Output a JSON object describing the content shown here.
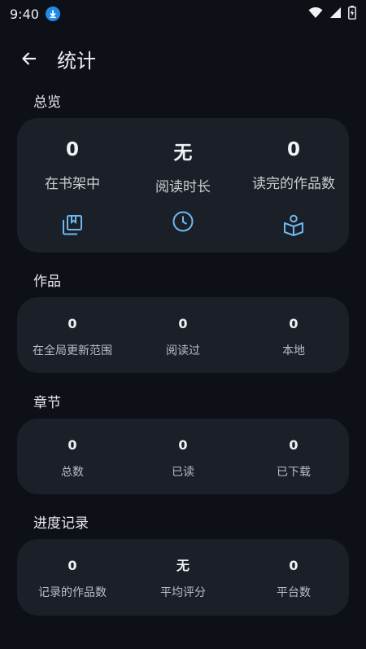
{
  "status_bar": {
    "time": "9:40"
  },
  "header": {
    "title": "统计"
  },
  "overview": {
    "section_title": "总览",
    "items": [
      {
        "value": "0",
        "label": "在书架中",
        "icon": "library-bookmark-icon"
      },
      {
        "value": "无",
        "label": "阅读时长",
        "icon": "clock-icon"
      },
      {
        "value": "0",
        "label": "读完的作品数",
        "icon": "reading-person-icon"
      }
    ],
    "accent_color": "#6db8f2"
  },
  "works": {
    "section_title": "作品",
    "items": [
      {
        "value": "0",
        "label": "在全局更新范围"
      },
      {
        "value": "0",
        "label": "阅读过"
      },
      {
        "value": "0",
        "label": "本地"
      }
    ]
  },
  "chapters": {
    "section_title": "章节",
    "items": [
      {
        "value": "0",
        "label": "总数"
      },
      {
        "value": "0",
        "label": "已读"
      },
      {
        "value": "0",
        "label": "已下载"
      }
    ]
  },
  "tracking": {
    "section_title": "进度记录",
    "items": [
      {
        "value": "0",
        "label": "记录的作品数"
      },
      {
        "value": "无",
        "label": "平均评分"
      },
      {
        "value": "0",
        "label": "平台数"
      }
    ]
  }
}
